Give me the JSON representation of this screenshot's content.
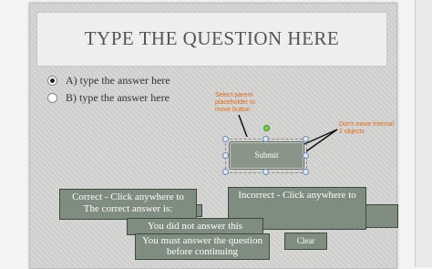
{
  "question_title": "TYPE THE QUESTION HERE",
  "answers": [
    {
      "prefix": "A)",
      "text": "type the answer here",
      "selected": true
    },
    {
      "prefix": "B)",
      "text": "type the answer here",
      "selected": false
    }
  ],
  "notes": {
    "select_parent": "Select parent placeholder to move button",
    "dont_move": "Don't move internal 2 objects"
  },
  "submit_label": "Submit",
  "feedback": {
    "correct": "Correct - Click anywhere to",
    "correct_answer": "The correct answer is:",
    "incorrect": "Incorrect - Click anywhere to",
    "no_answer": "You did not answer this",
    "must_answer": "You must answer the question before continuing"
  },
  "clear_label": "Clear",
  "colors": {
    "note_text": "#e26a1a",
    "button_fill": "#8a9488",
    "overlay_fill": "#7f8c80"
  }
}
